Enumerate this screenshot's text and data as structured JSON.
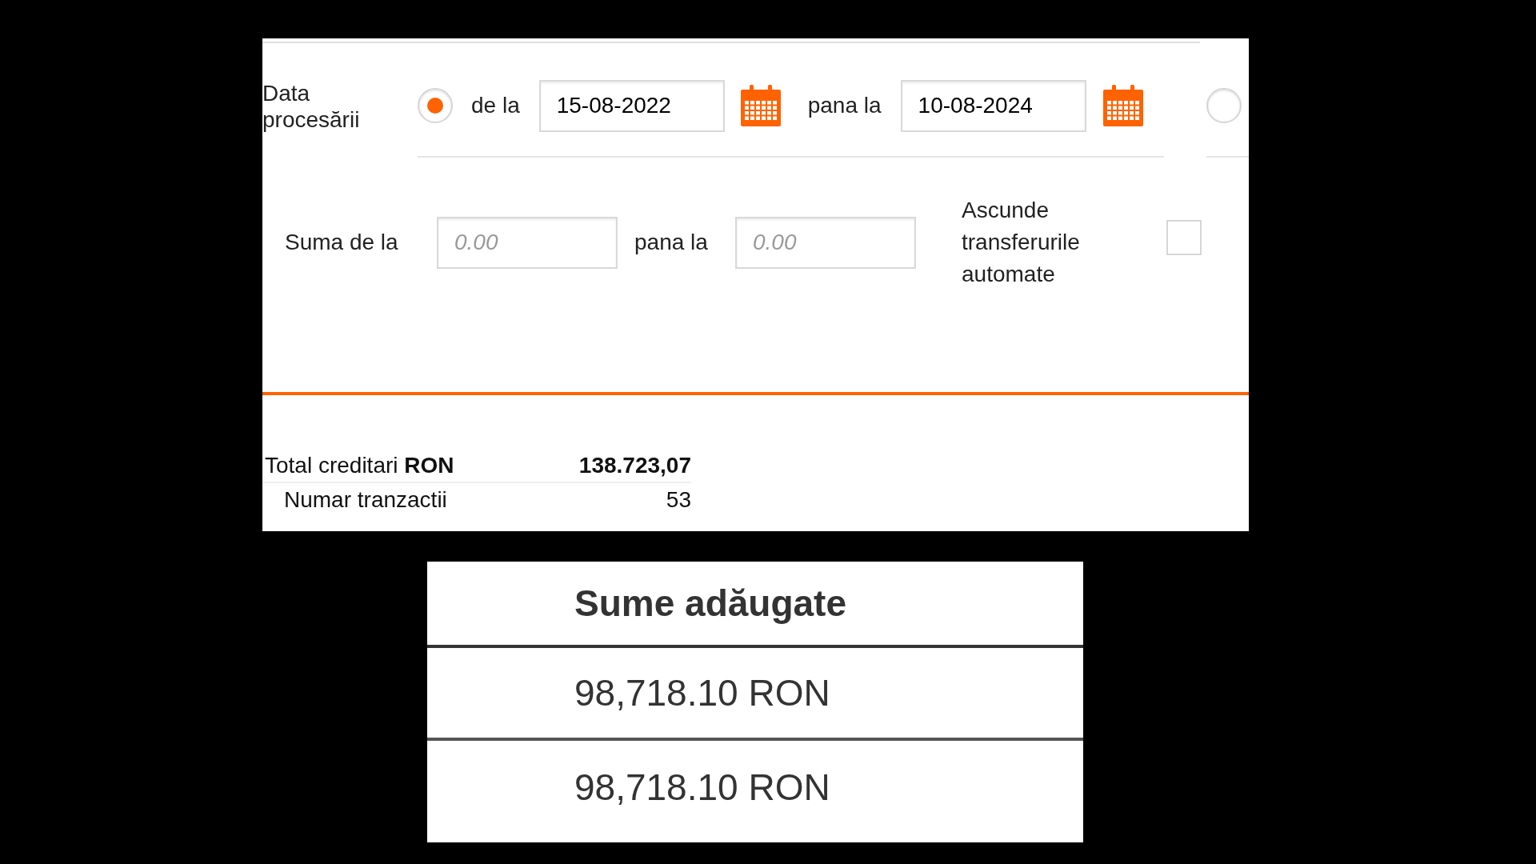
{
  "filter": {
    "date_label": "Data procesării",
    "date_range": {
      "selected": true,
      "from_label": "de la",
      "from_value": "15-08-2022",
      "to_label": "pana la",
      "to_value": "10-08-2024"
    },
    "other_option": {
      "selected": false
    },
    "amount_from_label": "Suma de la",
    "amount_from_placeholder": "0.00",
    "amount_to_label": "pana la",
    "amount_to_placeholder": "0.00",
    "hide_automatic": {
      "label": "Ascunde transferurile automate",
      "checked": false
    }
  },
  "totals": [
    {
      "label": "Total creditari **RON**",
      "value": "138.723,07",
      "kind": "bold"
    },
    {
      "label": "Numar tranzactii",
      "value": "53",
      "kind": "plain"
    }
  ],
  "table": {
    "column_header": "Sume adăugate",
    "rows": [
      "98,718.10 RON",
      "98,718.10 RON"
    ]
  }
}
